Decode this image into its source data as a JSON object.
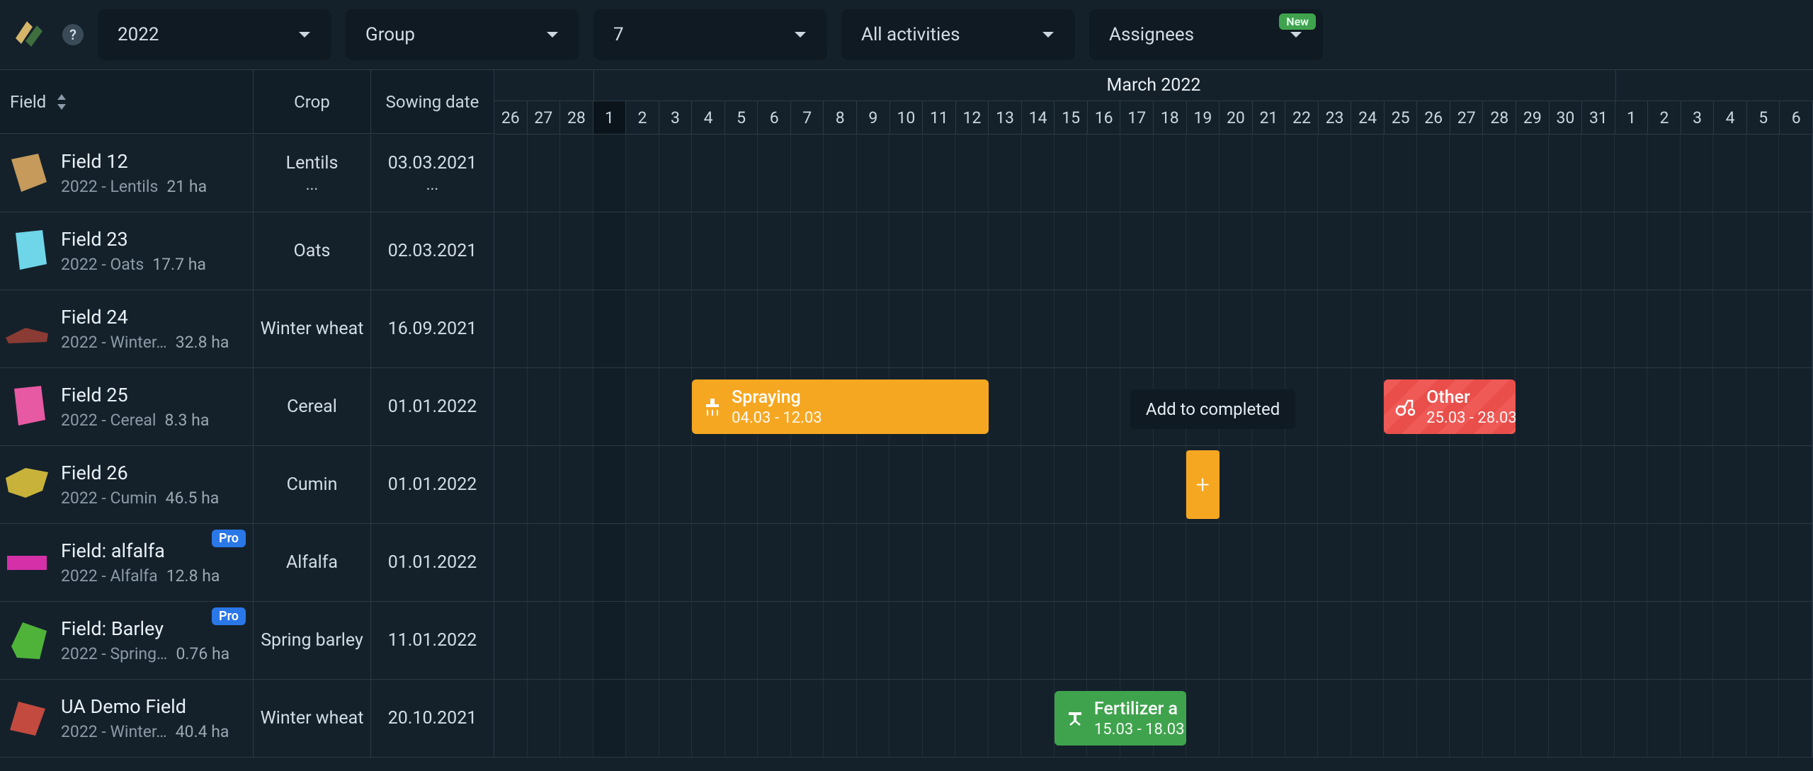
{
  "toolbar": {
    "year": "2022",
    "group": "Group",
    "count": "7",
    "activities": "All activities",
    "assignees": "Assignees",
    "new_badge": "New",
    "help": "?"
  },
  "headers": {
    "field": "Field",
    "crop": "Crop",
    "sowing_date": "Sowing date",
    "month": "March 2022"
  },
  "days": [
    "26",
    "27",
    "28",
    "1",
    "2",
    "3",
    "4",
    "5",
    "6",
    "7",
    "8",
    "9",
    "10",
    "11",
    "12",
    "13",
    "14",
    "15",
    "16",
    "17",
    "18",
    "19",
    "20",
    "21",
    "22",
    "23",
    "24",
    "25",
    "26",
    "27",
    "28",
    "29",
    "30",
    "31",
    "1",
    "2",
    "3",
    "4",
    "5",
    "6"
  ],
  "today_index": 3,
  "month_start_index": 3,
  "month_end_index": 33,
  "rows": [
    {
      "name": "Field 12",
      "crop_line": "2022 - Lentils",
      "area": "21 ha",
      "crop": "Lentils ...",
      "sowing": "03.03.2021 ...",
      "sowing_sub": "",
      "shape": "poly-brown",
      "pro": false
    },
    {
      "name": "Field 23",
      "crop_line": "2022 - Oats",
      "area": "17.7 ha",
      "crop": "Oats",
      "sowing": "02.03.2021",
      "shape": "rect-cyan",
      "pro": false
    },
    {
      "name": "Field 24",
      "crop_line": "2022 - Winter…",
      "area": "32.8 ha",
      "crop": "Winter wheat",
      "sowing": "16.09.2021",
      "shape": "poly-darkred",
      "pro": false
    },
    {
      "name": "Field 25",
      "crop_line": "2022 - Cereal",
      "area": "8.3 ha",
      "crop": "Cereal",
      "sowing": "01.01.2022",
      "shape": "para-pink",
      "pro": false
    },
    {
      "name": "Field 26",
      "crop_line": "2022 - Cumin",
      "area": "46.5 ha",
      "crop": "Cumin",
      "sowing": "01.01.2022",
      "shape": "poly-olive",
      "pro": false
    },
    {
      "name": "Field: alfalfa",
      "crop_line": "2022 - Alfalfa",
      "area": "12.8 ha",
      "crop": "Alfalfa",
      "sowing": "01.01.2022",
      "shape": "rect-magenta",
      "pro": true
    },
    {
      "name": "Field: Barley",
      "crop_line": "2022 - Spring…",
      "area": "0.76 ha",
      "crop": "Spring barley",
      "sowing": "11.01.2022",
      "shape": "poly-green",
      "pro": true
    },
    {
      "name": "UA Demo Field",
      "crop_line": "2022 - Winter…",
      "area": "40.4 ha",
      "crop": "Winter wheat",
      "sowing": "20.10.2021",
      "shape": "rhombus-red",
      "pro": false
    }
  ],
  "activities": {
    "spraying": {
      "title": "Spraying",
      "dates": "04.03 - 12.03"
    },
    "other": {
      "title": "Other",
      "dates": "25.03 - 28.03"
    },
    "fertilizer": {
      "title": "Fertilizer a",
      "dates": "15.03 - 18.03"
    }
  },
  "tooltip": "Add to completed",
  "plus": "+"
}
